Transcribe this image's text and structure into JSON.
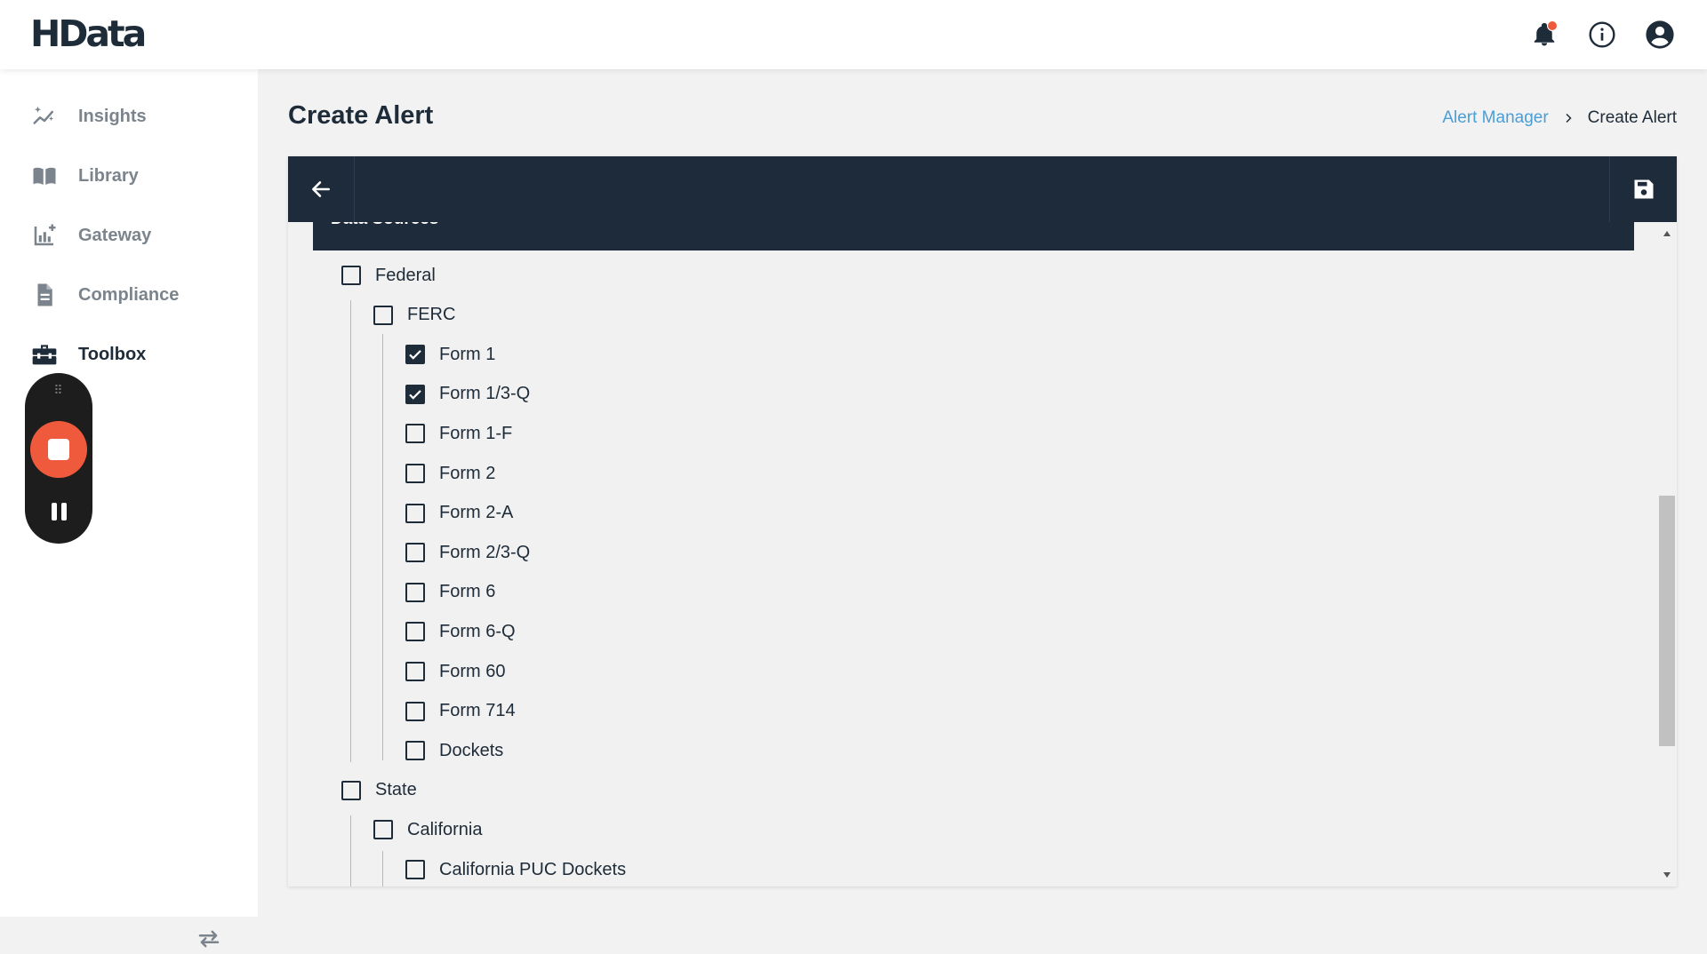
{
  "app": {
    "logo_text": "HData"
  },
  "topbar": {
    "icons": [
      "bell-icon",
      "info-icon",
      "account-icon"
    ],
    "notification_dot_color": "#f05a3c"
  },
  "sidebar": {
    "items": [
      {
        "label": "Insights",
        "icon": "sparkle-chart-icon",
        "active": false
      },
      {
        "label": "Library",
        "icon": "book-icon",
        "active": false
      },
      {
        "label": "Gateway",
        "icon": "chart-plus-icon",
        "active": false
      },
      {
        "label": "Compliance",
        "icon": "document-icon",
        "active": false
      },
      {
        "label": "Toolbox",
        "icon": "toolbox-icon",
        "active": true
      }
    ],
    "collapse_icon": "swap-arrows-icon"
  },
  "recorder": {
    "grip": "⠿",
    "stop_color": "#f05a3c"
  },
  "page": {
    "title": "Create Alert",
    "breadcrumb": {
      "parent": "Alert Manager",
      "current": "Create Alert"
    }
  },
  "panel": {
    "section_title": "Data Sources",
    "tree": [
      {
        "label": "Federal",
        "checked": false
      },
      {
        "label": "FERC",
        "checked": false
      },
      {
        "label": "Form 1",
        "checked": true
      },
      {
        "label": "Form 1/3-Q",
        "checked": true
      },
      {
        "label": "Form 1-F",
        "checked": false
      },
      {
        "label": "Form 2",
        "checked": false
      },
      {
        "label": "Form 2-A",
        "checked": false
      },
      {
        "label": "Form 2/3-Q",
        "checked": false
      },
      {
        "label": "Form 6",
        "checked": false
      },
      {
        "label": "Form 6-Q",
        "checked": false
      },
      {
        "label": "Form 60",
        "checked": false
      },
      {
        "label": "Form 714",
        "checked": false
      },
      {
        "label": "Dockets",
        "checked": false
      },
      {
        "label": "State",
        "checked": false
      },
      {
        "label": "California",
        "checked": false
      },
      {
        "label": "California PUC Dockets",
        "checked": false
      }
    ]
  },
  "colors": {
    "navy": "#1d2b3a",
    "link": "#4a9ed6",
    "muted_text": "#7b848d"
  }
}
